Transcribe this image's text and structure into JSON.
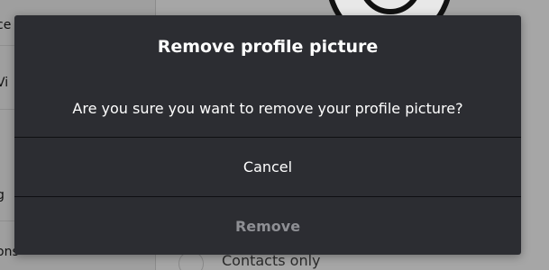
{
  "background": {
    "sidebar_fragments": [
      "ce",
      "Vi",
      "g",
      "ons"
    ],
    "option_label": "Contacts only"
  },
  "dialog": {
    "title": "Remove profile picture",
    "message": "Are you sure you want to remove your profile picture?",
    "cancel_label": "Cancel",
    "remove_label": "Remove",
    "remove_state": "disabled"
  },
  "colors": {
    "dialog_bg": "#2c2d32",
    "overlay_bg": "#a6a6a6",
    "text_primary": "#ffffff",
    "text_disabled": "#8e8f94"
  }
}
